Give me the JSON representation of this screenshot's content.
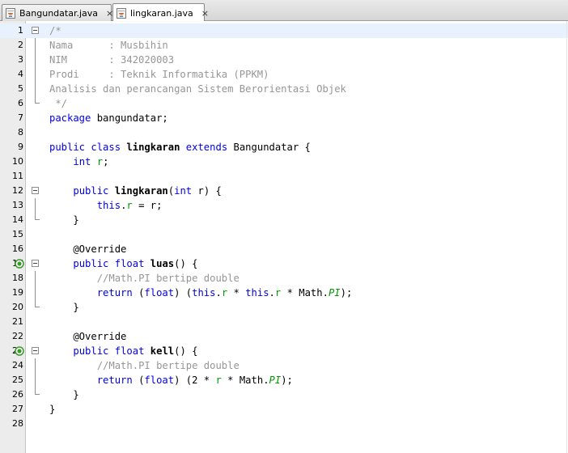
{
  "tabs": [
    {
      "label": "Bangundatar.java",
      "close": "×",
      "active": false
    },
    {
      "label": "lingkaran.java",
      "close": "×",
      "active": true
    }
  ],
  "colors": {
    "keyword": "#0000e6",
    "comment": "#969696",
    "field": "#009900",
    "gutter": "#ececec",
    "current_line": "#e8f2fe"
  },
  "code_lines": [
    {
      "n": "1",
      "fold": "open",
      "tokens": [
        {
          "t": "/*",
          "c": "comment"
        }
      ]
    },
    {
      "n": "2",
      "fold": "line",
      "tokens": [
        {
          "t": "Nama      : Musbihin",
          "c": "comment"
        }
      ]
    },
    {
      "n": "3",
      "fold": "line",
      "tokens": [
        {
          "t": "NIM       : 342020003",
          "c": "comment"
        }
      ]
    },
    {
      "n": "4",
      "fold": "line",
      "tokens": [
        {
          "t": "Prodi     : Teknik Informatika (PPKM)",
          "c": "comment"
        }
      ]
    },
    {
      "n": "5",
      "fold": "line",
      "tokens": [
        {
          "t": "Analisis dan perancangan Sistem Berorientasi Objek",
          "c": "comment"
        }
      ]
    },
    {
      "n": "6",
      "fold": "end",
      "tokens": [
        {
          "t": " */",
          "c": "comment"
        }
      ]
    },
    {
      "n": "7",
      "tokens": [
        {
          "t": "package",
          "c": "kw"
        },
        {
          "t": " bangundatar;",
          "c": "plain"
        }
      ]
    },
    {
      "n": "8",
      "tokens": []
    },
    {
      "n": "9",
      "tokens": [
        {
          "t": "public",
          "c": "kw"
        },
        {
          "t": " ",
          "c": "plain"
        },
        {
          "t": "class",
          "c": "kw"
        },
        {
          "t": " ",
          "c": "plain"
        },
        {
          "t": "lingkaran",
          "c": "bold"
        },
        {
          "t": " ",
          "c": "plain"
        },
        {
          "t": "extends",
          "c": "kw"
        },
        {
          "t": " Bangundatar {",
          "c": "plain"
        }
      ]
    },
    {
      "n": "10",
      "tokens": [
        {
          "t": "    ",
          "c": "plain"
        },
        {
          "t": "int",
          "c": "kw"
        },
        {
          "t": " ",
          "c": "plain"
        },
        {
          "t": "r",
          "c": "field"
        },
        {
          "t": ";",
          "c": "plain"
        }
      ]
    },
    {
      "n": "11",
      "tokens": []
    },
    {
      "n": "12",
      "fold": "open",
      "tokens": [
        {
          "t": "    ",
          "c": "plain"
        },
        {
          "t": "public",
          "c": "kw"
        },
        {
          "t": " ",
          "c": "plain"
        },
        {
          "t": "lingkaran",
          "c": "bold"
        },
        {
          "t": "(",
          "c": "plain"
        },
        {
          "t": "int",
          "c": "kw"
        },
        {
          "t": " r) {",
          "c": "plain"
        }
      ]
    },
    {
      "n": "13",
      "fold": "line",
      "tokens": [
        {
          "t": "        ",
          "c": "plain"
        },
        {
          "t": "this",
          "c": "kw"
        },
        {
          "t": ".",
          "c": "plain"
        },
        {
          "t": "r",
          "c": "field"
        },
        {
          "t": " = r;",
          "c": "plain"
        }
      ]
    },
    {
      "n": "14",
      "fold": "end",
      "tokens": [
        {
          "t": "    }",
          "c": "plain"
        }
      ]
    },
    {
      "n": "15",
      "tokens": []
    },
    {
      "n": "16",
      "tokens": [
        {
          "t": "    @Override",
          "c": "plain"
        }
      ]
    },
    {
      "n": "17",
      "fold": "open",
      "override": true,
      "tokens": [
        {
          "t": "    ",
          "c": "plain"
        },
        {
          "t": "public",
          "c": "kw"
        },
        {
          "t": " ",
          "c": "plain"
        },
        {
          "t": "float",
          "c": "kw"
        },
        {
          "t": " ",
          "c": "plain"
        },
        {
          "t": "luas",
          "c": "bold"
        },
        {
          "t": "() {",
          "c": "plain"
        }
      ]
    },
    {
      "n": "18",
      "fold": "line",
      "tokens": [
        {
          "t": "        ",
          "c": "plain"
        },
        {
          "t": "//Math.PI bertipe double",
          "c": "comment"
        }
      ]
    },
    {
      "n": "19",
      "fold": "line",
      "tokens": [
        {
          "t": "        ",
          "c": "plain"
        },
        {
          "t": "return",
          "c": "kw"
        },
        {
          "t": " (",
          "c": "plain"
        },
        {
          "t": "float",
          "c": "kw"
        },
        {
          "t": ") (",
          "c": "plain"
        },
        {
          "t": "this",
          "c": "kw"
        },
        {
          "t": ".",
          "c": "plain"
        },
        {
          "t": "r",
          "c": "field"
        },
        {
          "t": " * ",
          "c": "plain"
        },
        {
          "t": "this",
          "c": "kw"
        },
        {
          "t": ".",
          "c": "plain"
        },
        {
          "t": "r",
          "c": "field"
        },
        {
          "t": " * Math.",
          "c": "plain"
        },
        {
          "t": "PI",
          "c": "static"
        },
        {
          "t": ");",
          "c": "plain"
        }
      ]
    },
    {
      "n": "20",
      "fold": "end",
      "tokens": [
        {
          "t": "    }",
          "c": "plain"
        }
      ]
    },
    {
      "n": "21",
      "tokens": []
    },
    {
      "n": "22",
      "tokens": [
        {
          "t": "    @Override",
          "c": "plain"
        }
      ]
    },
    {
      "n": "23",
      "fold": "open",
      "override": true,
      "tokens": [
        {
          "t": "    ",
          "c": "plain"
        },
        {
          "t": "public",
          "c": "kw"
        },
        {
          "t": " ",
          "c": "plain"
        },
        {
          "t": "float",
          "c": "kw"
        },
        {
          "t": " ",
          "c": "plain"
        },
        {
          "t": "kell",
          "c": "bold"
        },
        {
          "t": "() {",
          "c": "plain"
        }
      ]
    },
    {
      "n": "24",
      "fold": "line",
      "tokens": [
        {
          "t": "        ",
          "c": "plain"
        },
        {
          "t": "//Math.PI bertipe double",
          "c": "comment"
        }
      ]
    },
    {
      "n": "25",
      "fold": "line",
      "tokens": [
        {
          "t": "        ",
          "c": "plain"
        },
        {
          "t": "return",
          "c": "kw"
        },
        {
          "t": " (",
          "c": "plain"
        },
        {
          "t": "float",
          "c": "kw"
        },
        {
          "t": ") (2 * ",
          "c": "plain"
        },
        {
          "t": "r",
          "c": "field"
        },
        {
          "t": " * Math.",
          "c": "plain"
        },
        {
          "t": "PI",
          "c": "static"
        },
        {
          "t": ");",
          "c": "plain"
        }
      ]
    },
    {
      "n": "26",
      "fold": "end",
      "tokens": [
        {
          "t": "    }",
          "c": "plain"
        }
      ]
    },
    {
      "n": "27",
      "tokens": [
        {
          "t": "}",
          "c": "plain"
        }
      ]
    },
    {
      "n": "28",
      "tokens": []
    }
  ]
}
